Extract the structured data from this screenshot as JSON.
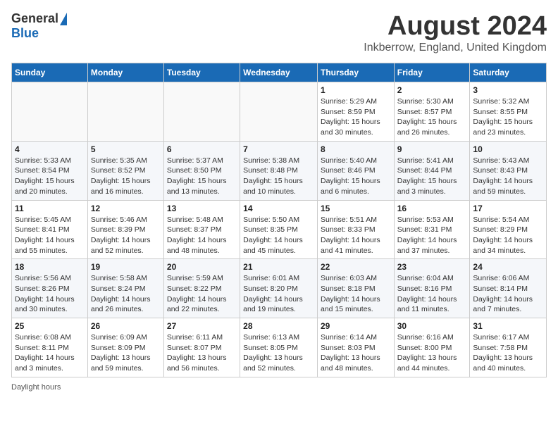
{
  "header": {
    "logo_general": "General",
    "logo_blue": "Blue",
    "month_title": "August 2024",
    "location": "Inkberrow, England, United Kingdom"
  },
  "days_of_week": [
    "Sunday",
    "Monday",
    "Tuesday",
    "Wednesday",
    "Thursday",
    "Friday",
    "Saturday"
  ],
  "weeks": [
    [
      {
        "day": "",
        "info": ""
      },
      {
        "day": "",
        "info": ""
      },
      {
        "day": "",
        "info": ""
      },
      {
        "day": "",
        "info": ""
      },
      {
        "day": "1",
        "info": "Sunrise: 5:29 AM\nSunset: 8:59 PM\nDaylight: 15 hours and 30 minutes."
      },
      {
        "day": "2",
        "info": "Sunrise: 5:30 AM\nSunset: 8:57 PM\nDaylight: 15 hours and 26 minutes."
      },
      {
        "day": "3",
        "info": "Sunrise: 5:32 AM\nSunset: 8:55 PM\nDaylight: 15 hours and 23 minutes."
      }
    ],
    [
      {
        "day": "4",
        "info": "Sunrise: 5:33 AM\nSunset: 8:54 PM\nDaylight: 15 hours and 20 minutes."
      },
      {
        "day": "5",
        "info": "Sunrise: 5:35 AM\nSunset: 8:52 PM\nDaylight: 15 hours and 16 minutes."
      },
      {
        "day": "6",
        "info": "Sunrise: 5:37 AM\nSunset: 8:50 PM\nDaylight: 15 hours and 13 minutes."
      },
      {
        "day": "7",
        "info": "Sunrise: 5:38 AM\nSunset: 8:48 PM\nDaylight: 15 hours and 10 minutes."
      },
      {
        "day": "8",
        "info": "Sunrise: 5:40 AM\nSunset: 8:46 PM\nDaylight: 15 hours and 6 minutes."
      },
      {
        "day": "9",
        "info": "Sunrise: 5:41 AM\nSunset: 8:44 PM\nDaylight: 15 hours and 3 minutes."
      },
      {
        "day": "10",
        "info": "Sunrise: 5:43 AM\nSunset: 8:43 PM\nDaylight: 14 hours and 59 minutes."
      }
    ],
    [
      {
        "day": "11",
        "info": "Sunrise: 5:45 AM\nSunset: 8:41 PM\nDaylight: 14 hours and 55 minutes."
      },
      {
        "day": "12",
        "info": "Sunrise: 5:46 AM\nSunset: 8:39 PM\nDaylight: 14 hours and 52 minutes."
      },
      {
        "day": "13",
        "info": "Sunrise: 5:48 AM\nSunset: 8:37 PM\nDaylight: 14 hours and 48 minutes."
      },
      {
        "day": "14",
        "info": "Sunrise: 5:50 AM\nSunset: 8:35 PM\nDaylight: 14 hours and 45 minutes."
      },
      {
        "day": "15",
        "info": "Sunrise: 5:51 AM\nSunset: 8:33 PM\nDaylight: 14 hours and 41 minutes."
      },
      {
        "day": "16",
        "info": "Sunrise: 5:53 AM\nSunset: 8:31 PM\nDaylight: 14 hours and 37 minutes."
      },
      {
        "day": "17",
        "info": "Sunrise: 5:54 AM\nSunset: 8:29 PM\nDaylight: 14 hours and 34 minutes."
      }
    ],
    [
      {
        "day": "18",
        "info": "Sunrise: 5:56 AM\nSunset: 8:26 PM\nDaylight: 14 hours and 30 minutes."
      },
      {
        "day": "19",
        "info": "Sunrise: 5:58 AM\nSunset: 8:24 PM\nDaylight: 14 hours and 26 minutes."
      },
      {
        "day": "20",
        "info": "Sunrise: 5:59 AM\nSunset: 8:22 PM\nDaylight: 14 hours and 22 minutes."
      },
      {
        "day": "21",
        "info": "Sunrise: 6:01 AM\nSunset: 8:20 PM\nDaylight: 14 hours and 19 minutes."
      },
      {
        "day": "22",
        "info": "Sunrise: 6:03 AM\nSunset: 8:18 PM\nDaylight: 14 hours and 15 minutes."
      },
      {
        "day": "23",
        "info": "Sunrise: 6:04 AM\nSunset: 8:16 PM\nDaylight: 14 hours and 11 minutes."
      },
      {
        "day": "24",
        "info": "Sunrise: 6:06 AM\nSunset: 8:14 PM\nDaylight: 14 hours and 7 minutes."
      }
    ],
    [
      {
        "day": "25",
        "info": "Sunrise: 6:08 AM\nSunset: 8:11 PM\nDaylight: 14 hours and 3 minutes."
      },
      {
        "day": "26",
        "info": "Sunrise: 6:09 AM\nSunset: 8:09 PM\nDaylight: 13 hours and 59 minutes."
      },
      {
        "day": "27",
        "info": "Sunrise: 6:11 AM\nSunset: 8:07 PM\nDaylight: 13 hours and 56 minutes."
      },
      {
        "day": "28",
        "info": "Sunrise: 6:13 AM\nSunset: 8:05 PM\nDaylight: 13 hours and 52 minutes."
      },
      {
        "day": "29",
        "info": "Sunrise: 6:14 AM\nSunset: 8:03 PM\nDaylight: 13 hours and 48 minutes."
      },
      {
        "day": "30",
        "info": "Sunrise: 6:16 AM\nSunset: 8:00 PM\nDaylight: 13 hours and 44 minutes."
      },
      {
        "day": "31",
        "info": "Sunrise: 6:17 AM\nSunset: 7:58 PM\nDaylight: 13 hours and 40 minutes."
      }
    ]
  ],
  "footer": {
    "daylight_label": "Daylight hours"
  }
}
